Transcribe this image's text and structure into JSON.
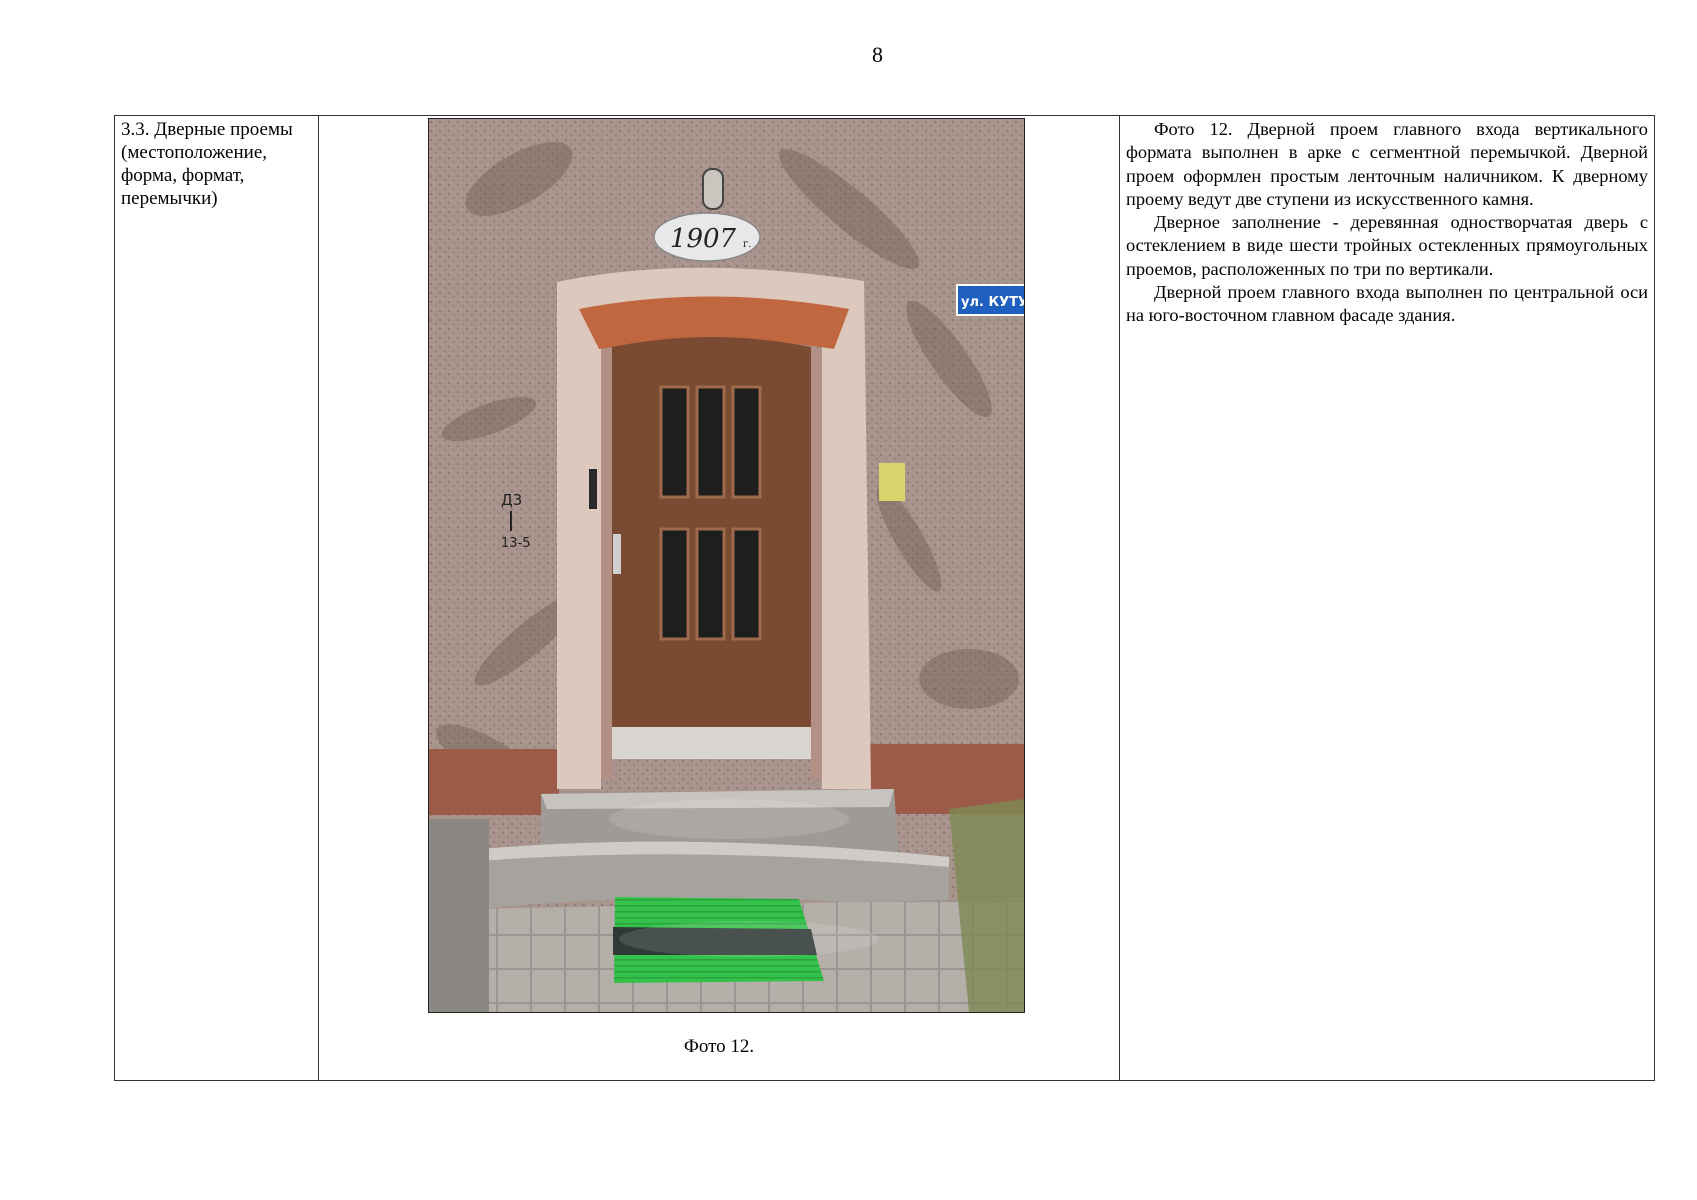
{
  "page": {
    "number": "8"
  },
  "row": {
    "label": "3.3. Дверные проемы (местоположение, форма, формат, перемычки)",
    "photo": {
      "caption": "Фото 12.",
      "date_plaque": "1907",
      "date_plaque_suffix": "г.",
      "street_sign": "ул. КУТУЗ",
      "wall_marking_top": "Д3",
      "wall_marking_bottom": "13-5"
    },
    "description": [
      "Фото 12. Дверной проем главного входа вертикального формата выполнен в арке с сегментной перемычкой. Дверной проем оформлен простым ленточным наличником. К дверному проему ведут две ступени из искусственного камня.",
      "Дверное заполнение - деревянная одностворчатая дверь с остеклением в виде шести тройных остекленных прямоугольных проемов, расположенных по три по вертикали.",
      "Дверной проем главного входа выполнен по центральной оси на юго-восточном главном фасаде здания."
    ]
  },
  "colors": {
    "wall": "#a8948c",
    "door": "#7a4a33",
    "surround": "#ddc8bd",
    "mat_green": "#34c24a",
    "sign_blue": "#1f5fbf"
  }
}
